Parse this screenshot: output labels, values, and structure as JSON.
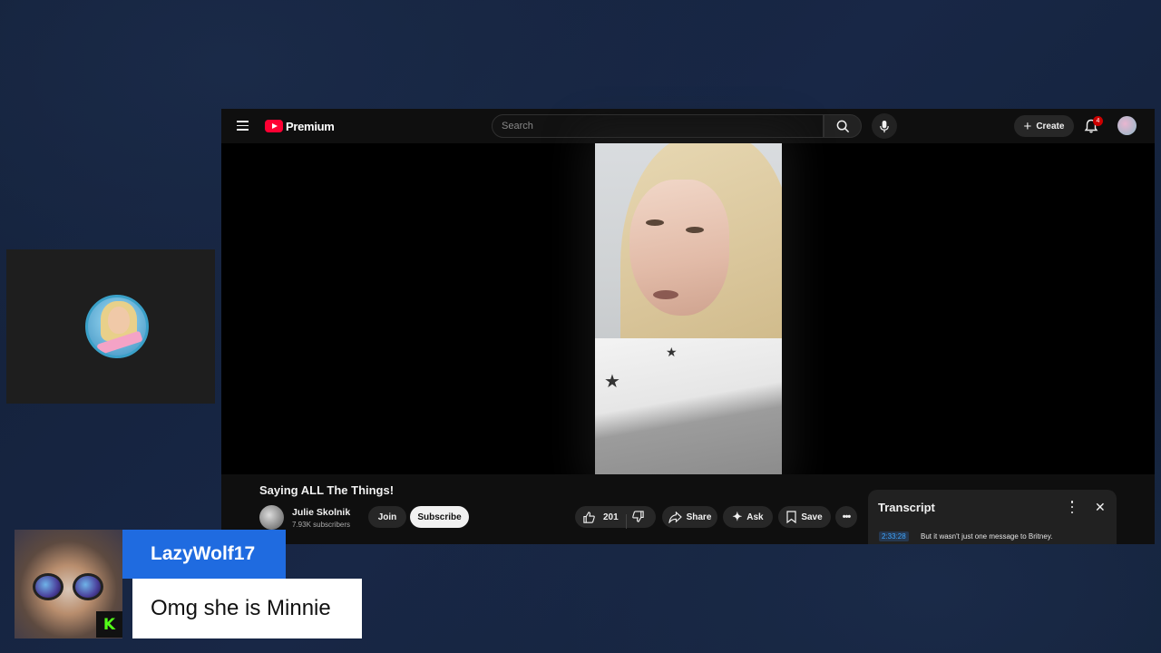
{
  "youtube": {
    "logo_text": "Premium",
    "search_placeholder": "Search",
    "create_label": "Create",
    "notification_count": "4",
    "video_title": "Saying ALL The Things!",
    "channel_name": "Julie Skolnik",
    "subscribers": "7.93K subscribers",
    "join_label": "Join",
    "subscribe_label": "Subscribe",
    "like_count": "201",
    "share_label": "Share",
    "ask_label": "Ask",
    "save_label": "Save"
  },
  "transcript": {
    "title": "Transcript",
    "timestamp": "2:33:28",
    "line": "But it wasn't just one message to Britney."
  },
  "chat": {
    "username": "LazyWolf17",
    "message": "Omg she is Minnie",
    "platform_badge": "K",
    "username_color": "#1f6be0"
  },
  "colors": {
    "youtube_red": "#ff0033",
    "background": "#142038"
  }
}
